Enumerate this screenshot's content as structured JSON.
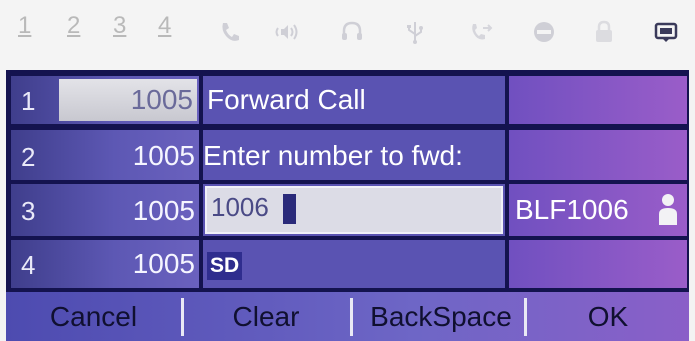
{
  "status_bar": {
    "line_numbers": [
      "1",
      "2",
      "3",
      "4"
    ],
    "icons": [
      "phone-icon",
      "speaker-icon",
      "headset-icon",
      "usb-icon",
      "call-forward-icon",
      "do-not-disturb-icon",
      "lock-icon",
      "message-icon"
    ]
  },
  "line_keys": [
    {
      "number": "1",
      "extension": "1005"
    },
    {
      "number": "2",
      "extension": "1005"
    },
    {
      "number": "3",
      "extension": "1005"
    },
    {
      "number": "4",
      "extension": "1005"
    }
  ],
  "forward": {
    "title": "Forward Call",
    "prompt": "Enter number to fwd:",
    "input_value": "1006",
    "input_mode": "SD"
  },
  "right_keys": {
    "blf_label": "BLF1006"
  },
  "softkeys": {
    "cancel": "Cancel",
    "clear": "Clear",
    "backspace": "BackSpace",
    "ok": "OK"
  },
  "colors": {
    "panel_dark": "#14134f",
    "line_key_bg": "#5d58b4",
    "right_key_bg": "#9a5dc9",
    "input_bg": "#dcdce6"
  }
}
